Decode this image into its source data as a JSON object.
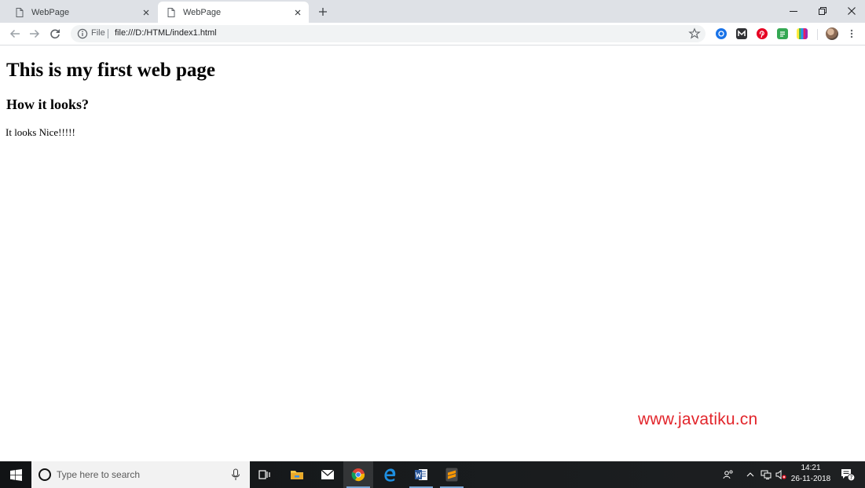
{
  "browser": {
    "tabs": [
      {
        "title": "WebPage",
        "active": false
      },
      {
        "title": "WebPage",
        "active": true
      }
    ],
    "omnibox": {
      "scheme_label": "File",
      "url": "file:///D:/HTML/index1.html"
    },
    "icons": [
      "back-icon",
      "forward-icon",
      "reload-icon",
      "info-icon",
      "star-icon",
      "new-tab-icon",
      "minimize-icon",
      "restore-icon",
      "close-icon",
      "menu-icon"
    ]
  },
  "page": {
    "heading1": "This is my first web page",
    "heading3": "How it looks?",
    "paragraph": "It looks Nice!!!!!",
    "watermark": "www.javatiku.cn"
  },
  "taskbar": {
    "search_placeholder": "Type here to search",
    "time": "14:21",
    "date": "26-11-2018",
    "notification_count": "7",
    "icons": [
      "windows-icon",
      "cortana-icon",
      "mic-icon",
      "task-view-icon",
      "file-explorer-icon",
      "mail-icon",
      "chrome-icon",
      "edge-icon",
      "word-icon",
      "sublime-icon",
      "people-icon",
      "chevron-up-icon",
      "network-icon",
      "volume-muted-icon",
      "action-center-icon"
    ]
  },
  "colors": {
    "tabstrip": "#dee1e6",
    "omnibox": "#f1f3f4",
    "watermark": "#e2252b",
    "taskbar": "#171a1c"
  }
}
